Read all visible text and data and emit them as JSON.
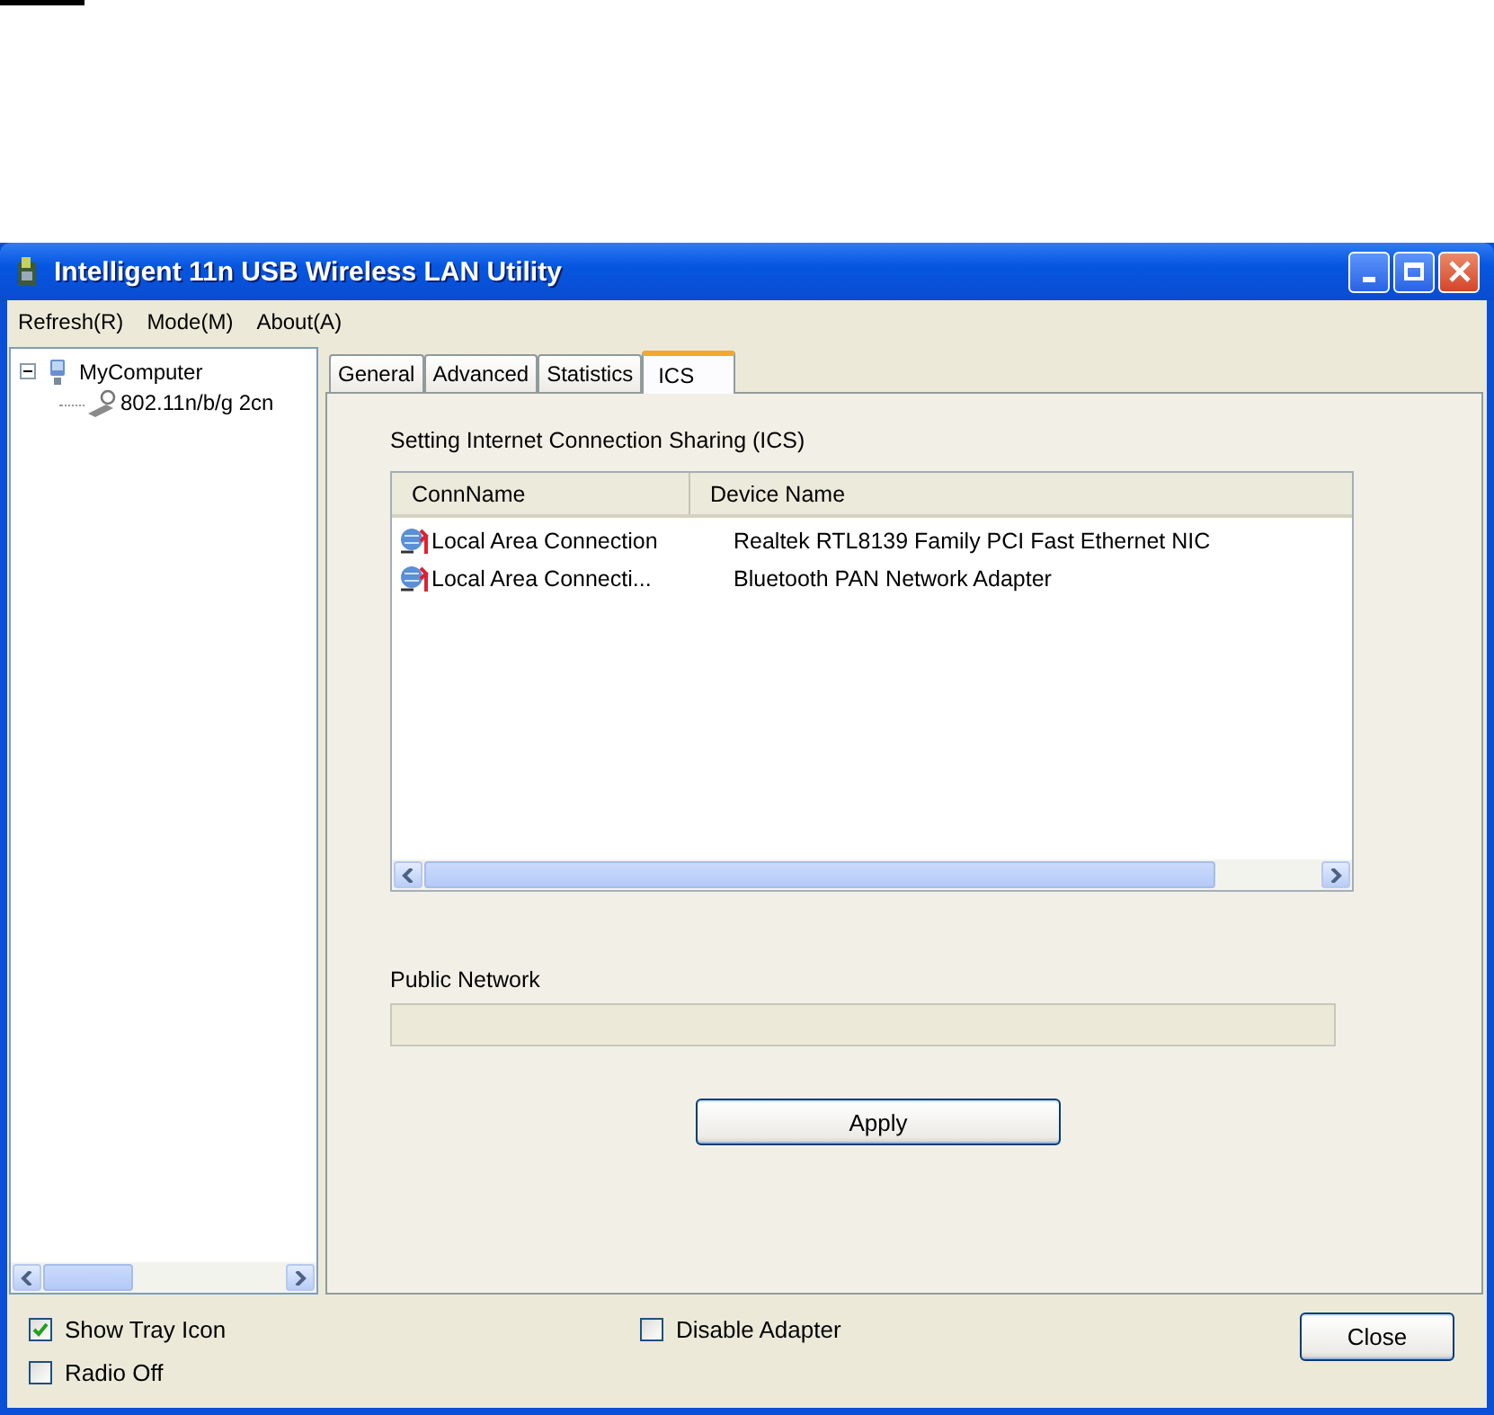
{
  "window": {
    "title": "Intelligent 11n USB Wireless LAN Utility"
  },
  "menu": [
    "Refresh(R)",
    "Mode(M)",
    "About(A)"
  ],
  "tree": [
    {
      "label": "MyComputer",
      "expanded": true,
      "children": [
        {
          "label": "802.11n/b/g 2cn"
        }
      ]
    }
  ],
  "tabs": [
    {
      "label": "General",
      "selected": false
    },
    {
      "label": "Advanced",
      "selected": false
    },
    {
      "label": "Statistics",
      "selected": false
    },
    {
      "label": "ICS",
      "selected": true
    }
  ],
  "ics": {
    "heading": "Setting Internet Connection Sharing (ICS)",
    "columns": [
      "ConnName",
      "Device Name"
    ],
    "rows": [
      {
        "conn_name": "Local Area Connection",
        "device_name": "Realtek RTL8139 Family PCI Fast Ethernet NIC"
      },
      {
        "conn_name": "Local Area Connecti...",
        "device_name": "Bluetooth PAN Network Adapter"
      }
    ],
    "public_network_label": "Public Network",
    "apply": "Apply"
  },
  "options": [
    {
      "label": "Show Tray Icon",
      "checked": true
    },
    {
      "label": "Radio Off",
      "checked": false
    },
    {
      "label": "Disable Adapter",
      "checked": false
    }
  ],
  "close": "Close"
}
